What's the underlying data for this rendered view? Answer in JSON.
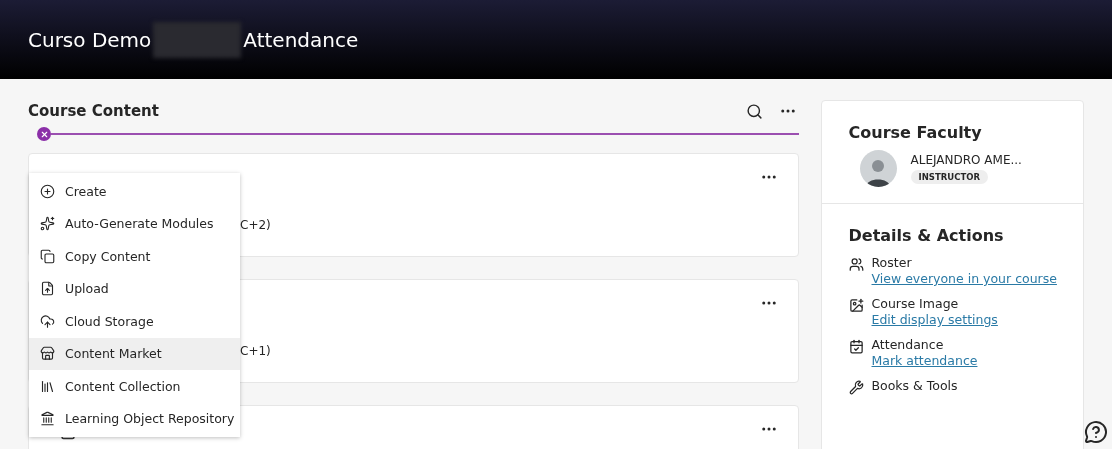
{
  "header": {
    "title_start": "Curso Demo",
    "title_end": "Attendance"
  },
  "content": {
    "title": "Course Content",
    "cards": [
      {
        "kind": "text",
        "snippet": "C+2)"
      },
      {
        "kind": "text",
        "snippet": "C+1)"
      },
      {
        "kind": "partial"
      }
    ],
    "menu": [
      {
        "label": "Create",
        "selected": false
      },
      {
        "label": "Auto-Generate Modules",
        "selected": false
      },
      {
        "label": "Copy Content",
        "selected": false
      },
      {
        "label": "Upload",
        "selected": false
      },
      {
        "label": "Cloud Storage",
        "selected": false
      },
      {
        "label": "Content Market",
        "selected": true
      },
      {
        "label": "Content Collection",
        "selected": false
      },
      {
        "label": "Learning Object Repository",
        "selected": false
      }
    ]
  },
  "sidebar": {
    "faculty_title": "Course Faculty",
    "faculty_name": "ALEJANDRO AME...",
    "faculty_role": "INSTRUCTOR",
    "details_title": "Details & Actions",
    "actions": [
      {
        "label": "Roster",
        "link": "View everyone in your course"
      },
      {
        "label": "Course Image",
        "link": "Edit display settings"
      },
      {
        "label": "Attendance",
        "link": "Mark attendance"
      },
      {
        "label": "Books & Tools"
      }
    ]
  }
}
